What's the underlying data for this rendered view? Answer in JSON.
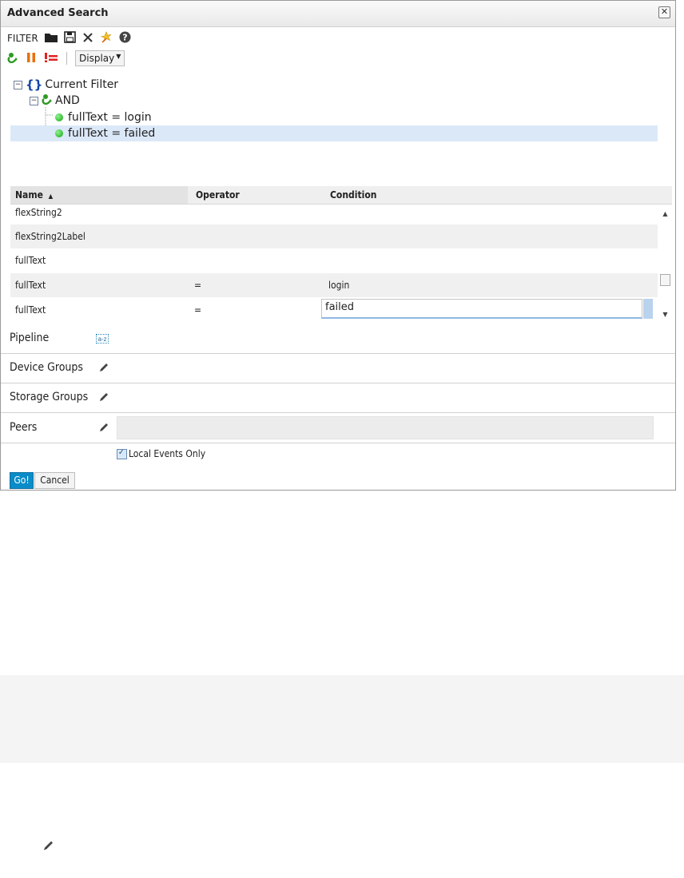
{
  "dialog": {
    "title": "Advanced Search",
    "close_icon": "close-icon"
  },
  "toolbar": {
    "filter_label": "FILTER",
    "icons": [
      "open-folder-icon",
      "save-icon",
      "delete-icon",
      "magic-wand-icon",
      "help-icon"
    ],
    "condition_icons": [
      "and-icon",
      "or-icon",
      "not-icon"
    ],
    "display_label": "Display"
  },
  "tree": {
    "root_label": "Current Filter",
    "and_label": "AND",
    "conditions": [
      "fullText = login",
      "fullText = failed"
    ]
  },
  "grid": {
    "headers": {
      "name": "Name",
      "operator": "Operator",
      "condition": "Condition"
    },
    "rows": [
      {
        "name": "flexString2",
        "operator": "",
        "condition": ""
      },
      {
        "name": "flexString2Label",
        "operator": "",
        "condition": ""
      },
      {
        "name": "fullText",
        "operator": "",
        "condition": ""
      },
      {
        "name": "fullText",
        "operator": "=",
        "condition": "login"
      },
      {
        "name": "fullText",
        "operator": "=",
        "condition": "failed"
      }
    ]
  },
  "sections": {
    "pipeline": "Pipeline",
    "pipeline_icon_text": "a-z",
    "device_groups": "Device Groups",
    "storage_groups": "Storage Groups",
    "peers": "Peers",
    "peers_value": ""
  },
  "options": {
    "local_events_only": "Local Events Only",
    "local_events_checked": true
  },
  "actions": {
    "go": "Go!",
    "cancel": "Cancel"
  },
  "colors": {
    "accent": "#0a8cc8",
    "selection": "#dbe8f8",
    "and_green": "#2e9a24",
    "or_orange": "#e8700d",
    "not_red": "#e02020"
  }
}
